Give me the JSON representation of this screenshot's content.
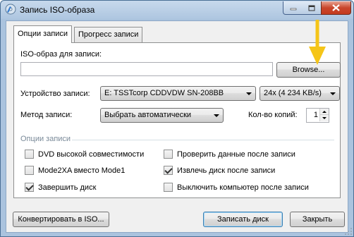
{
  "window": {
    "title": "Запись ISO-образа",
    "icon": "disc-burn-icon"
  },
  "title_buttons": [
    "minimize-icon",
    "maximize-icon",
    "close-icon"
  ],
  "tabs": [
    {
      "label": "Опции записи",
      "active": true
    },
    {
      "label": "Прогресс записи",
      "active": false
    }
  ],
  "iso": {
    "label": "ISO-образ для записи:",
    "value": "",
    "browse_label": "Browse..."
  },
  "device": {
    "label": "Устройство записи:",
    "selected": "E: TSSTcorp CDDVDW SN-208BB",
    "speed": "24x (4 234 KB/s)"
  },
  "method": {
    "label": "Метод записи:",
    "selected": "Выбрать автоматически"
  },
  "copies": {
    "label": "Кол-во копий:",
    "value": "1"
  },
  "options_group": {
    "title": "Опции записи",
    "items": [
      {
        "label": "DVD высокой совместимости",
        "checked": false
      },
      {
        "label": "Проверить данные после записи",
        "checked": false
      },
      {
        "label": "Mode2XA вместо Mode1",
        "checked": false
      },
      {
        "label": "Извлечь диск после записи",
        "checked": true
      },
      {
        "label": "Завершить диск",
        "checked": true
      },
      {
        "label": "Выключить компьютер после записи",
        "checked": false
      }
    ]
  },
  "buttons": {
    "convert": "Конвертировать в ISO...",
    "burn": "Записать диск",
    "close": "Закрыть"
  },
  "colors": {
    "titlebar": "#aec6e0",
    "close_button": "#c43a1e",
    "annotation_arrow": "#f5c518",
    "group_title": "#7a8a99"
  }
}
